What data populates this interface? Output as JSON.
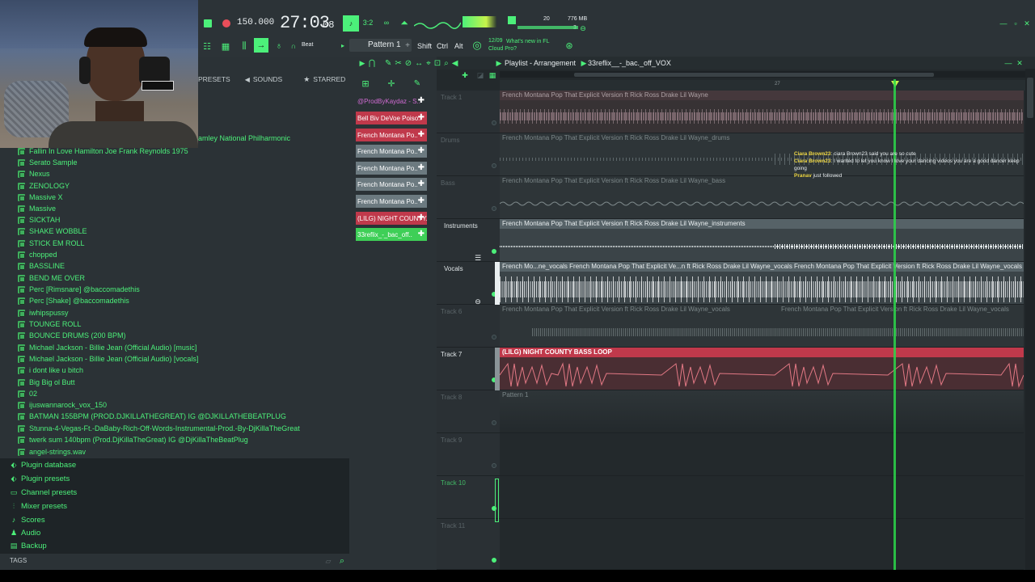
{
  "transport": {
    "tempo": "150.000",
    "time": "27:03",
    "time_sub": "08",
    "time_label": "B:S:T",
    "pattern": "Pattern 1",
    "cpu": "20",
    "memory": "776 MB",
    "voices": "3",
    "snap_label": "Beat",
    "shift_label": "Shift",
    "ctrl_label": "Ctrl",
    "alt_label": "Alt",
    "news_date": "12/09",
    "news_text": "What's new in FL Cloud Pro?"
  },
  "browser": {
    "tabs": [
      "PRESETS",
      "SOUNDS",
      "STARRED"
    ],
    "header_item": "amley National Philharmonic",
    "items": [
      "Fallin In Love  Hamilton Joe Frank  Reynolds  1975",
      "Serato Sample",
      "Nexus",
      "ZENOLOGY",
      "Massive X",
      "Massive",
      "SICKTAH",
      "SHAKE WOBBLE",
      "STICK EM ROLL",
      "chopped",
      "BASSLINE",
      "BEND ME OVER",
      "Perc [Rimsnare] @baccomadethis",
      "Perc [Shake] @baccomadethis",
      "iwhipspussy",
      "TOUNGE ROLL",
      "BOUNCE DRUMS (200 BPM)",
      "Michael Jackson - Billie Jean (Official Audio) [music]",
      "Michael Jackson - Billie Jean (Official Audio) [vocals]",
      "i dont like u bitch",
      "Big Big ol Butt",
      "02",
      "ijuswannarock_vox_150",
      "BATMAN 155BPM (PROD.DJKILLATHEGREAT) IG @DJKILLATHEBEATPLUG",
      "Stunna-4-Vegas-Ft.-DaBaby-Rich-Off-Words-Instrumental-Prod.-By-DjKillaTheGreat",
      "twerk sum 140bpm (Prod.DjKillaTheGreat) IG @DjKillaTheBeatPlug",
      "angel-strings.wav"
    ],
    "bottom_items": [
      {
        "label": "Plugin database",
        "icon": "plug-icon"
      },
      {
        "label": "Plugin presets",
        "icon": "plug-icon"
      },
      {
        "label": "Channel presets",
        "icon": "channel-icon"
      },
      {
        "label": "Mixer presets",
        "icon": "mixer-icon"
      },
      {
        "label": "Scores",
        "icon": "note-icon"
      },
      {
        "label": "Audio",
        "icon": "person-icon"
      },
      {
        "label": "Backup",
        "icon": "folder-icon"
      }
    ],
    "tags_label": "TAGS"
  },
  "channels": [
    {
      "label": "@ProdByKaydaz - S..",
      "color": "#2b3236",
      "text": "#d06bd2"
    },
    {
      "label": "Bell Biv DeVoe  Poiso..",
      "color": "#c0394b",
      "text": "#ffffff"
    },
    {
      "label": "French Montana  Po..",
      "color": "#c0394b",
      "text": "#ffffff"
    },
    {
      "label": "French Montana  Po..",
      "color": "#6c7a80",
      "text": "#ffffff"
    },
    {
      "label": "French Montana  Po..",
      "color": "#6c7a80",
      "text": "#ffffff"
    },
    {
      "label": "French Montana  Po..",
      "color": "#6c7a80",
      "text": "#ffffff"
    },
    {
      "label": "French Montana  Po..",
      "color": "#6c7a80",
      "text": "#ffffff"
    },
    {
      "label": "(LILG) NIGHT COUNTY..",
      "color": "#c0394b",
      "text": "#ffffff"
    },
    {
      "label": "33reflix_-_bac_off..",
      "color": "#3ecf57",
      "text": "#ffffff"
    }
  ],
  "playlist": {
    "title": "Playlist - Arrangement",
    "pattern_name": "33reflix__-_bac._off_VOX",
    "bar_marker": "27",
    "tracks": [
      {
        "name": "Track 1",
        "clip": "French Montana  Pop That Explicit Version ft Rick Ross Drake Lil Wayne",
        "active": false
      },
      {
        "name": "Drums",
        "clip": "French Montana  Pop That Explicit Version ft Rick Ross Drake Lil Wayne_drums",
        "active": false
      },
      {
        "name": "Bass",
        "clip": "French Montana  Pop That Explicit Version ft Rick Ross Drake Lil Wayne_bass",
        "active": false
      },
      {
        "name": "Instruments",
        "clip": "French Montana  Pop That Explicit Version ft Rick Ross Drake Lil Wayne_instruments",
        "active": true
      },
      {
        "name": "Vocals",
        "clip": "French Mo...ne_vocals  French Montana  Pop That Explicit Ve...n ft Rick Ross Drake Lil Wayne_vocals  French Montana  Pop That Explicit Version ft Rick Ross Drake Lil Wayne_vocals  French Montana  Pop That Explicit Ve...n ft Rick Ross Drake Lil Wayne_vocals  Frenc...ocals",
        "active": true
      },
      {
        "name": "Track 6",
        "clip": "French Montana  Pop That Explicit Version ft Rick Ross Drake Lil Wayne_vocals",
        "clip2": "French Montana  Pop That Explicit Version ft Rick Ross Drake Lil Wayne_vocals",
        "active": false
      },
      {
        "name": "Track 7",
        "clip": "(LILG) NIGHT COUNTY BASS LOOP",
        "active": true
      },
      {
        "name": "Track 8",
        "clip": "Pattern 1",
        "active": false
      },
      {
        "name": "Track 9",
        "clip": "",
        "active": false
      },
      {
        "name": "Track 10",
        "clip": "",
        "active": true
      },
      {
        "name": "Track 11",
        "clip": "",
        "active": false
      }
    ]
  },
  "chat": [
    {
      "user": "Ciara Brown23",
      "text": ": ciara Brown23 said you are so cute"
    },
    {
      "user": "Ciara Brown23",
      "text": ": I wanted to let you know I love your dancing videos you are a good dancer keep going"
    },
    {
      "user": "Pranav",
      "text": " just followed"
    }
  ],
  "colors": {
    "accent": "#4cf07a",
    "playhead": "#2bd64a",
    "red_track": "#c0394b"
  }
}
